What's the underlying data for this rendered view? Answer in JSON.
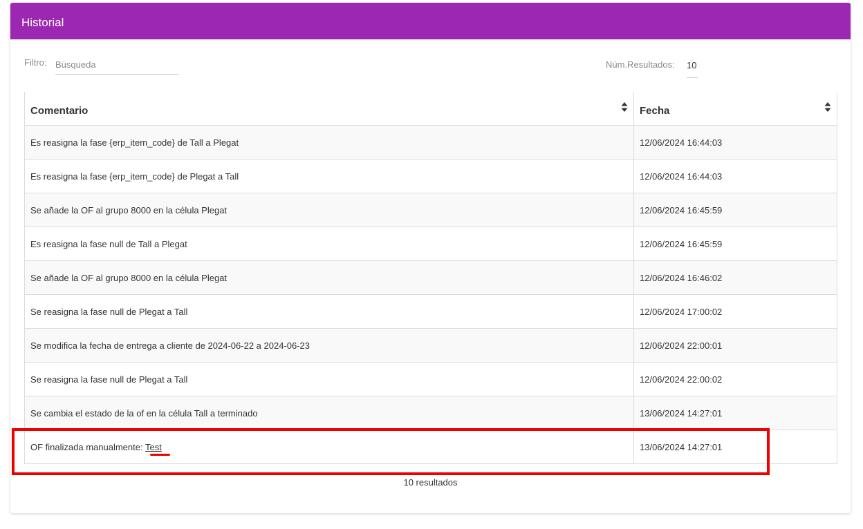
{
  "header": {
    "title": "Historial"
  },
  "filter": {
    "label": "Filtro:",
    "placeholder": "Búsqueda",
    "value": ""
  },
  "results_per_page": {
    "label": "Núm.Resultados:",
    "value": "10"
  },
  "table": {
    "columns": [
      "Comentario",
      "Fecha"
    ],
    "rows": [
      {
        "comment": "Es reasigna la fase {erp_item_code} de Tall a Plegat",
        "date": "12/06/2024 16:44:03"
      },
      {
        "comment": "Es reasigna la fase {erp_item_code} de Plegat a Tall",
        "date": "12/06/2024 16:44:03"
      },
      {
        "comment": "Se añade la OF al grupo 8000 en la célula Plegat",
        "date": "12/06/2024 16:45:59"
      },
      {
        "comment": "Es reasigna la fase null de Tall a Plegat",
        "date": "12/06/2024 16:45:59"
      },
      {
        "comment": "Se añade la OF al grupo 8000 en la célula Plegat",
        "date": "12/06/2024 16:46:02"
      },
      {
        "comment": "Se reasigna la fase null de Plegat a Tall",
        "date": "12/06/2024 17:00:02"
      },
      {
        "comment": "Se modifica la fecha de entrega a cliente de 2024-06-22 a 2024-06-23",
        "date": "12/06/2024 22:00:01"
      },
      {
        "comment": "Se reasigna la fase null de Plegat a Tall",
        "date": "12/06/2024 22:00:02"
      },
      {
        "comment": "Se cambia el estado de la of en la célula Tall a terminado",
        "date": "13/06/2024 14:27:01"
      },
      {
        "comment": "OF finalizada manualmente: ",
        "comment_link": "Test",
        "date": "13/06/2024 14:27:01"
      }
    ]
  },
  "footer": {
    "count_text": "10 resultados"
  },
  "colors": {
    "header_bg": "#9c27b0",
    "highlight": "#ee0000"
  }
}
